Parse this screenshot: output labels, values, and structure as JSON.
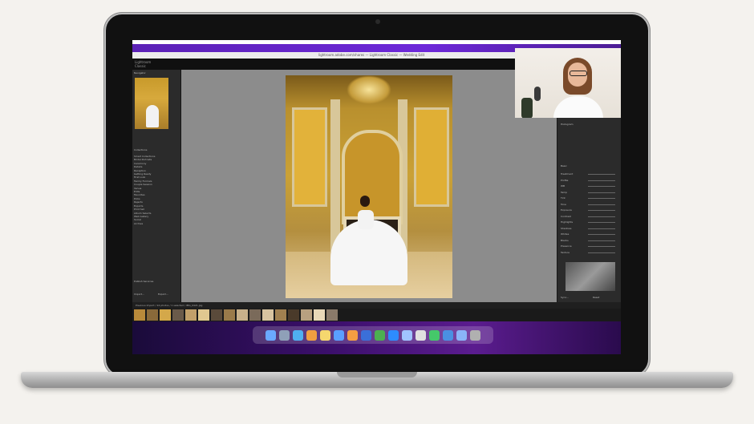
{
  "browser": {
    "address": "lightroom.adobe.com/shares — Lightroom Classic — Wedding Edit"
  },
  "lightroom": {
    "logo_line1": "Lightroom",
    "logo_line2": "Classic",
    "left_panel": {
      "navigator_label": "Navigator",
      "collections_label": "Collections",
      "collections": [
        "Smart Collections",
        "Bridal Portraits",
        "Ceremony",
        "Details",
        "Reception",
        "Getting Ready",
        "First Look",
        "Family Formals",
        "Couple Session",
        "Venue",
        "Edits",
        "Favorites",
        "Picks",
        "Rejects",
        "Exports",
        "Print Set",
        "Album Selects",
        "Web Gallery",
        "Social",
        "Archive"
      ],
      "publish_label": "Publish Services",
      "import_button": "Import...",
      "export_button": "Export..."
    },
    "right_panel": {
      "histogram_label": "Histogram",
      "basic_label": "Basic",
      "rows": [
        "Treatment",
        "Profile",
        "WB",
        "Temp",
        "Tint",
        "Tone",
        "Exposure",
        "Contrast",
        "Highlights",
        "Shadows",
        "Whites",
        "Blacks",
        "Presence",
        "Texture"
      ],
      "sync_button": "Sync...",
      "reset_button": "Reset"
    },
    "filmstrip": {
      "info": "Previous Import  /  24 photos / 1 selected / IMG_0421.jpg"
    }
  },
  "colors": {
    "accent_purple": "#6d28d9",
    "lr_panel": "#2b2b2b",
    "canvas_gray": "#8c8c8c"
  },
  "dock": {
    "icons": [
      "finder-icon",
      "launchpad-icon",
      "safari-icon",
      "photos-icon",
      "notes-icon",
      "mail-icon",
      "pages-icon",
      "lightroom-icon",
      "chrome-icon",
      "zoom-icon",
      "preview-icon",
      "files-icon",
      "messages-icon",
      "folder-icon",
      "downloads-icon",
      "trash-icon"
    ]
  }
}
